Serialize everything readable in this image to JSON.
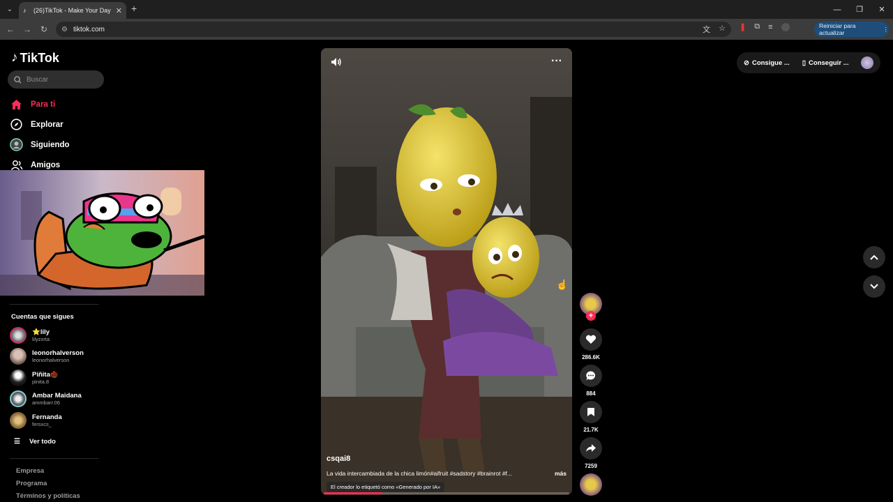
{
  "browser": {
    "tab_title": "(26)TikTok - Make Your Day",
    "address": "tiktok.com",
    "update_button": "Reiniciar para actualizar"
  },
  "sidebar": {
    "logo": "TikTok",
    "search_placeholder": "Buscar",
    "nav": [
      {
        "label": "Para ti",
        "active": true
      },
      {
        "label": "Explorar"
      },
      {
        "label": "Siguiendo"
      },
      {
        "label": "Amigos"
      }
    ],
    "following_title": "Cuentas que sigues",
    "following": [
      {
        "name": "⭐lily",
        "user": "lilyzxrta"
      },
      {
        "name": "leonorhalverson",
        "user": "leonorhalverson"
      },
      {
        "name": "Piñita🌰",
        "user": "pinita.8"
      },
      {
        "name": "Ambar Maidana",
        "user": "ammbarr.06"
      },
      {
        "name": "Fernanda",
        "user": "fersxcs_"
      }
    ],
    "see_all": "Ver todo",
    "footer": [
      "Empresa",
      "Programa",
      "Términos y políticas"
    ]
  },
  "video": {
    "author": "csqai8",
    "description": "La vida intercambiada de la chica limón#aifruit #sadstory #brainrot #f...",
    "more": "más",
    "ai_label": "El creador lo etiquetó como «Generado por IA»",
    "progress": 0.24
  },
  "actions": {
    "likes": "286.6K",
    "comments": "884",
    "saves": "21.7K",
    "shares": "7259"
  },
  "top_right": {
    "pill1": "Consigue ...",
    "pill2": "Conseguir ..."
  },
  "colors": {
    "accent": "#fe2c55",
    "active_nav": "#fe2c55"
  }
}
